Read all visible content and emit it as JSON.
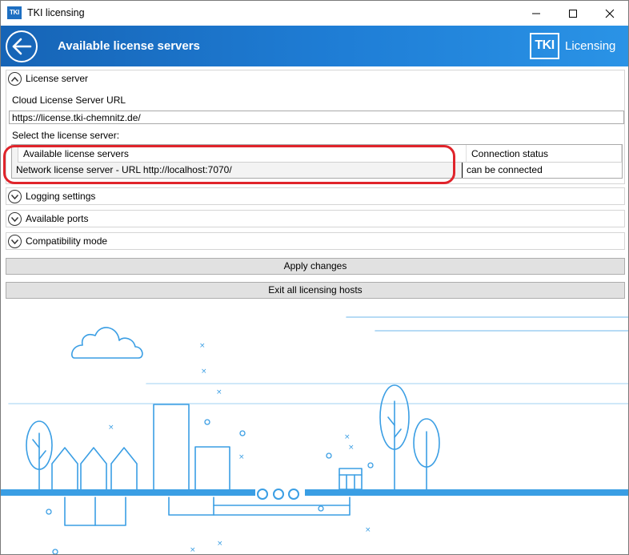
{
  "window": {
    "icon_text": "TKI",
    "title": "TKI licensing"
  },
  "header": {
    "title": "Available license servers",
    "brand_logo": "TKI",
    "brand_name": "Licensing"
  },
  "license_server": {
    "label": "License server",
    "cloud_url_label": "Cloud License Server URL",
    "cloud_url_value": "https://license.tki-chemnitz.de/",
    "select_label": "Select the license server:",
    "grid": {
      "columns": [
        "Available license servers",
        "Connection status"
      ],
      "rows": [
        {
          "server": "Network license server - URL http://localhost:7070/",
          "status": "can be connected"
        }
      ]
    }
  },
  "sections": {
    "logging": "Logging settings",
    "ports": "Available ports",
    "compatibility": "Compatibility mode"
  },
  "buttons": {
    "apply": "Apply changes",
    "exit_hosts": "Exit all licensing hosts"
  },
  "colors": {
    "accent": "#1f7ed6",
    "highlight": "#e0242b",
    "illustration": "#3a9ee4"
  }
}
